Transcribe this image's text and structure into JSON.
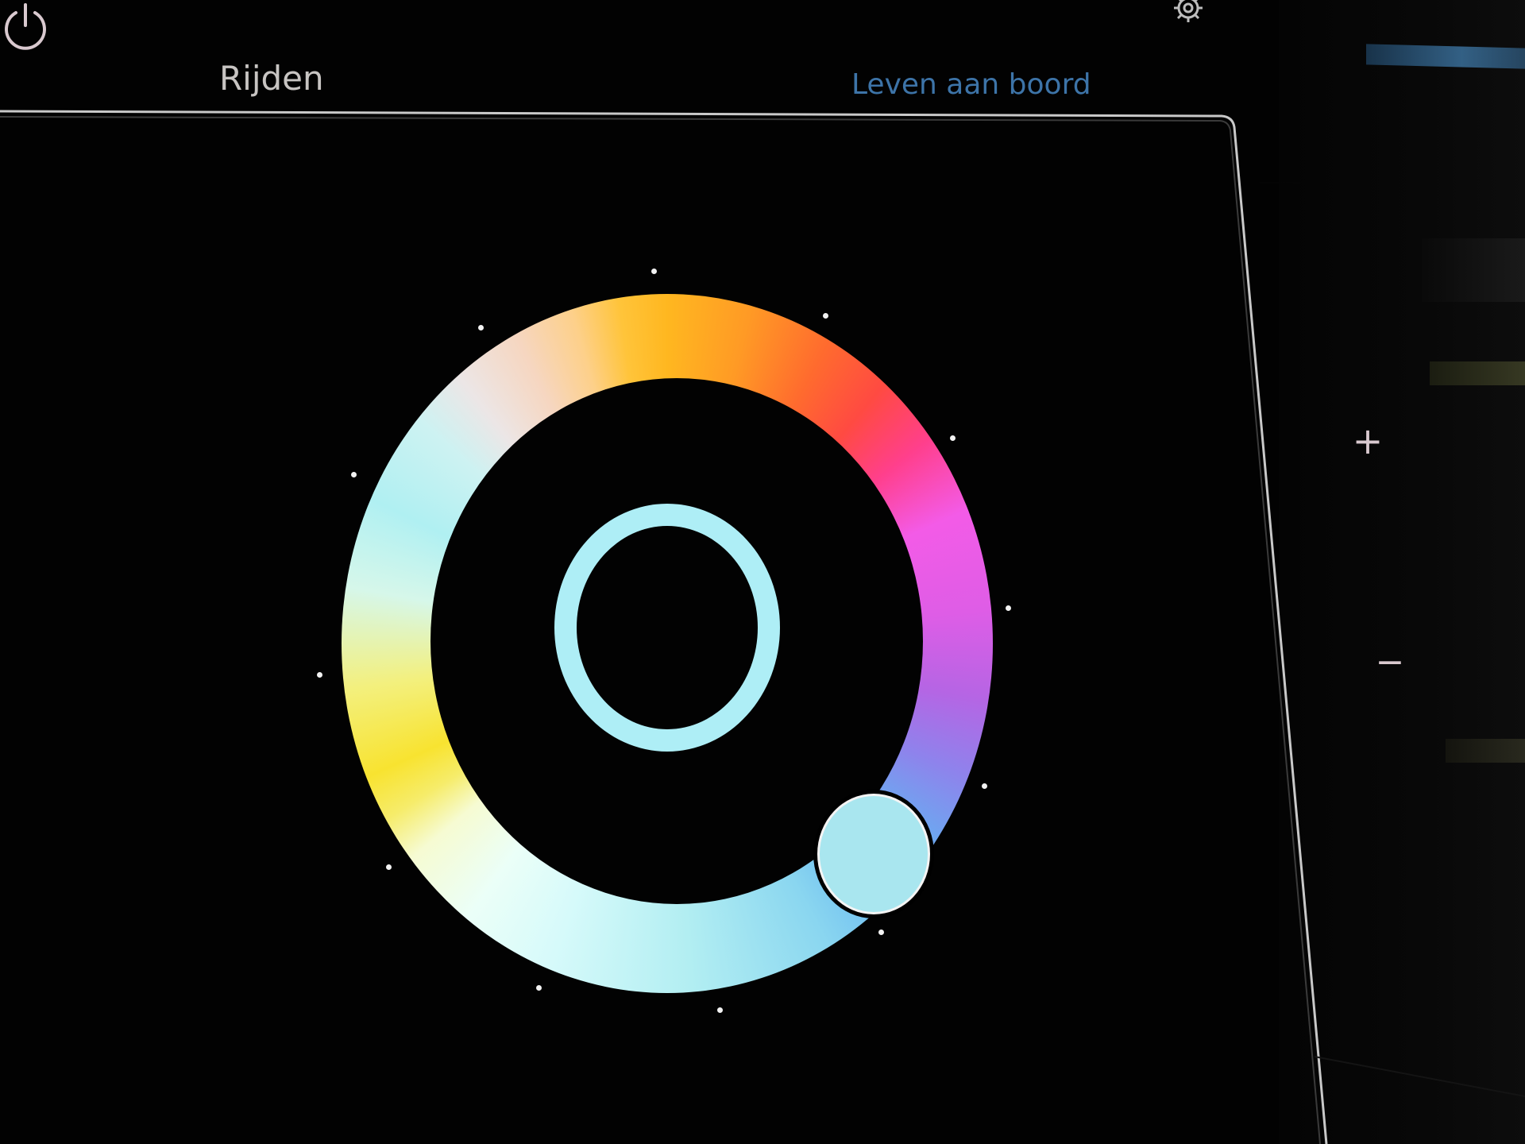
{
  "tabs": [
    {
      "label": "Rijden",
      "active": false
    },
    {
      "label": "Leven aan boord",
      "active": true
    }
  ],
  "side_controls": {
    "plus": "+",
    "minus": "−",
    "power_icon": "power-icon",
    "settings_icon": "gear-icon"
  },
  "colors": {
    "active_tab": "#3d74a8",
    "inactive_tab": "#c7c4c2",
    "selected_color": "#a9e6ef",
    "center_ring": "#aeeef6",
    "background": "#020202"
  },
  "color_picker": {
    "selected_hue_swatch": "#a9e6ef"
  }
}
